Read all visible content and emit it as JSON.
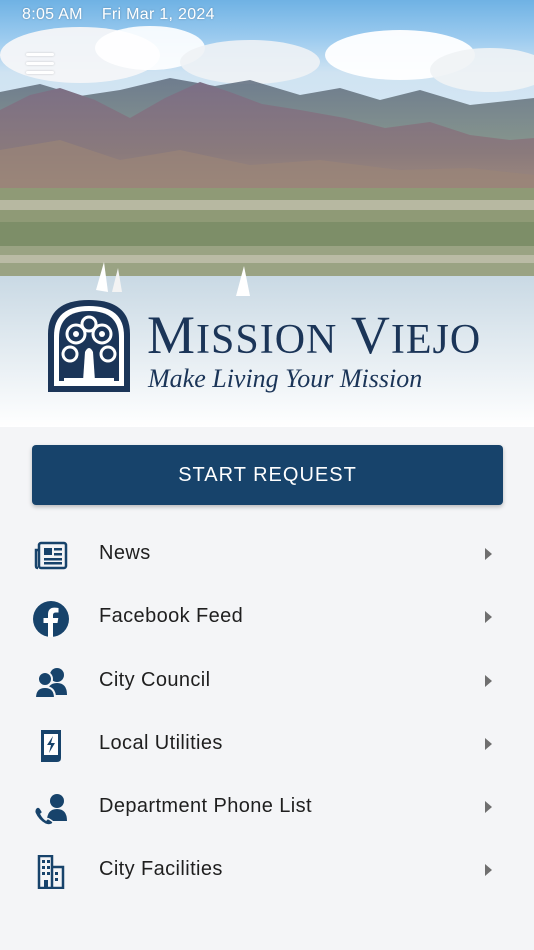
{
  "status_bar": {
    "time": "8:05 AM",
    "date": "Fri Mar 1, 2024"
  },
  "header": {
    "menu_icon": "hamburger-icon",
    "logo": {
      "title_M": "M",
      "title_ission": "ISSION",
      "title_V": "V",
      "title_iejo": "IEJO",
      "tagline": "Make Living Your Mission"
    }
  },
  "start_request": {
    "label": "START REQUEST"
  },
  "menu": {
    "items": [
      {
        "label": "News",
        "icon": "newspaper-icon"
      },
      {
        "label": "Facebook Feed",
        "icon": "facebook-icon"
      },
      {
        "label": "City Council",
        "icon": "people-icon"
      },
      {
        "label": "Local Utilities",
        "icon": "utility-bill-icon"
      },
      {
        "label": "Department Phone List",
        "icon": "phone-contact-icon"
      },
      {
        "label": "City Facilities",
        "icon": "building-icon"
      }
    ]
  },
  "colors": {
    "primary": "#17436b",
    "logo": "#1b3558",
    "background": "#f4f5f7",
    "chevron": "#6f6f6f"
  }
}
